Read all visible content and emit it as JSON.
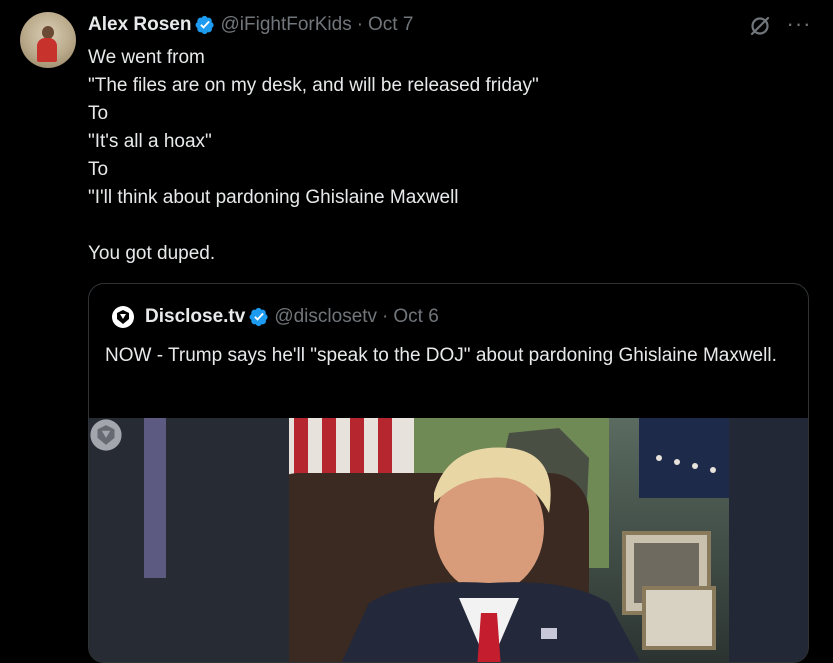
{
  "tweet": {
    "author_name": "Alex Rosen",
    "handle": "@iFightForKids",
    "separator": "·",
    "date": "Oct 7",
    "lines": [
      "We went from",
      "\"The files are on my desk, and will be released friday\"",
      "To",
      "\"It's all a hoax\"",
      "To",
      "\"I'll think about pardoning Ghislaine Maxwell",
      "",
      "You got duped."
    ]
  },
  "quote": {
    "author_name": "Disclose.tv",
    "handle": "@disclosetv",
    "separator": "·",
    "date": "Oct 6",
    "text": "NOW - Trump says he'll \"speak to the DOJ\" about pardoning Ghislaine Maxwell."
  },
  "icons": {
    "verified": "verified-badge-icon",
    "grok": "grok-icon",
    "more": "more-icon",
    "quote_logo": "disclosetv-logo-icon"
  },
  "colors": {
    "background": "#000000",
    "text": "#e7e9ea",
    "secondary_text": "#71767b",
    "verified": "#1d9bf0",
    "border": "#2f3336"
  }
}
